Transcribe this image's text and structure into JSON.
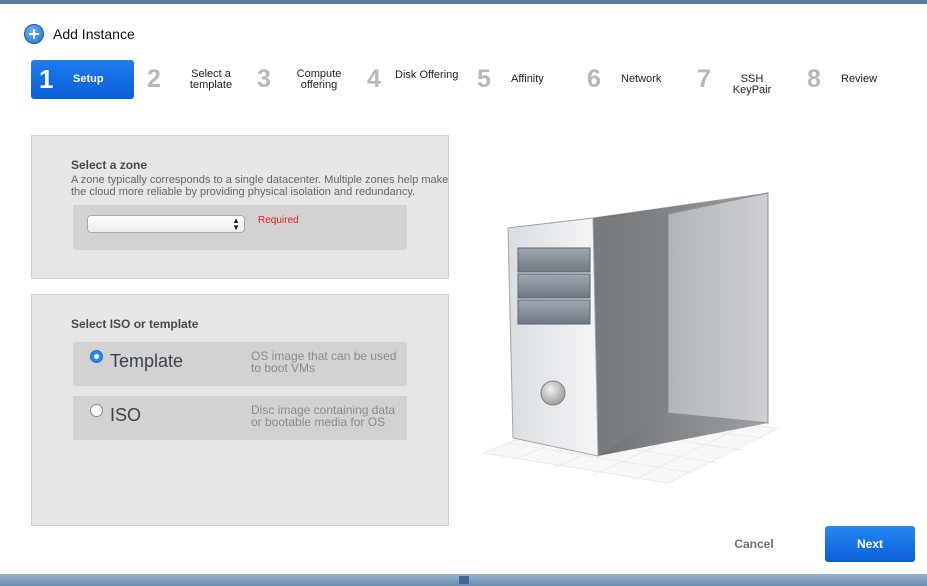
{
  "dialog": {
    "title": "Add Instance"
  },
  "steps": [
    {
      "number": "1",
      "label": "Setup",
      "active": true
    },
    {
      "number": "2",
      "label": "Select a template"
    },
    {
      "number": "3",
      "label": "Compute offering"
    },
    {
      "number": "4",
      "label": "Disk Offering"
    },
    {
      "number": "5",
      "label": "Affinity"
    },
    {
      "number": "6",
      "label": "Network"
    },
    {
      "number": "7",
      "label": "SSH KeyPair"
    },
    {
      "number": "8",
      "label": "Review"
    }
  ],
  "zone": {
    "heading": "Select a zone",
    "description": "A zone typically corresponds to a single datacenter. Multiple zones help make the cloud more reliable by providing physical isolation and redundancy.",
    "selected_value": "",
    "required_text": "Required"
  },
  "iso_template": {
    "heading": "Select ISO or template",
    "options": [
      {
        "title": "Template",
        "description": "OS image that can be used to boot VMs",
        "checked": true
      },
      {
        "title": "ISO",
        "description": "Disc image containing data or bootable media for OS",
        "checked": false
      }
    ]
  },
  "buttons": {
    "cancel": "Cancel",
    "next": "Next"
  },
  "colors": {
    "accent": "#1e7cf0",
    "required": "#e02020",
    "panel": "#e6e6e6"
  }
}
